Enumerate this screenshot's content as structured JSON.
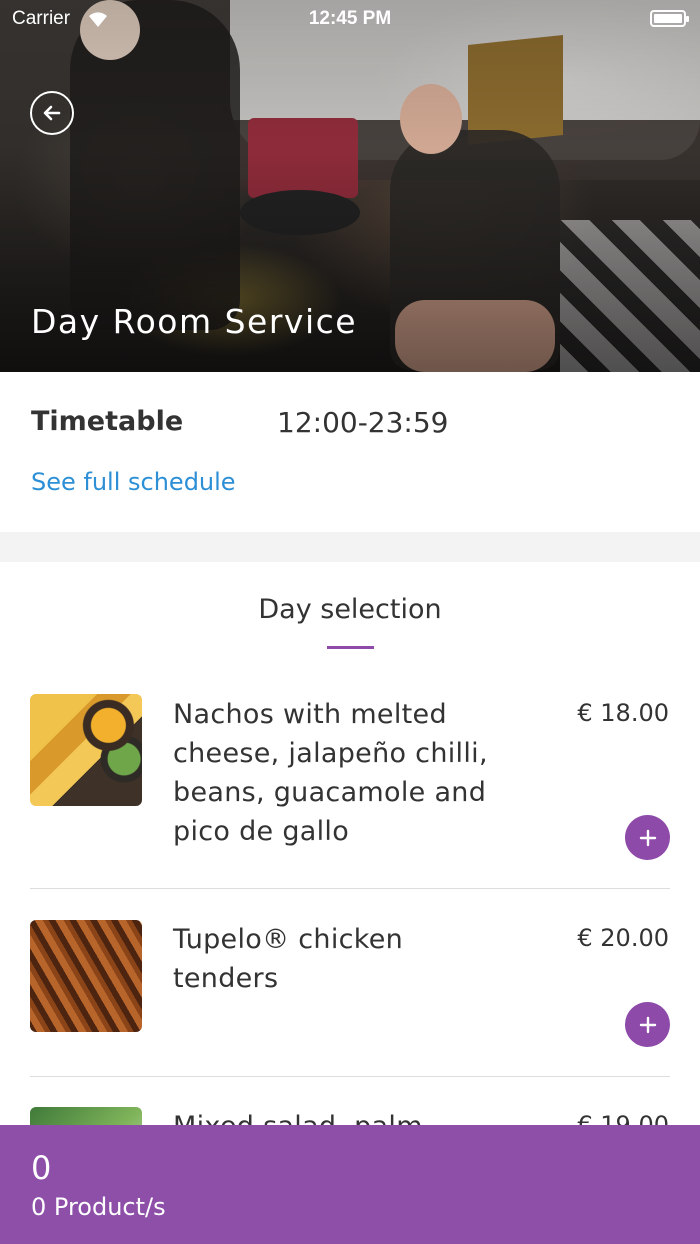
{
  "status_bar": {
    "carrier": "Carrier",
    "time": "12:45 PM"
  },
  "header": {
    "title": "Day Room Service",
    "back_icon": "arrow-left-circle-icon"
  },
  "timetable": {
    "label": "Timetable",
    "hours": "12:00-23:59",
    "schedule_link": "See full schedule"
  },
  "section": {
    "title": "Day selection"
  },
  "menu_items": [
    {
      "name": "Nachos with melted cheese, jalapeño chilli, beans, guacamole and pico de gallo",
      "price": "€ 18.00",
      "image": "nachos-photo"
    },
    {
      "name": "Tupelo® chicken tenders",
      "price": "€ 20.00",
      "image": "chicken-tenders-photo"
    },
    {
      "name": "Mixed salad, palm",
      "price": "€ 19.00",
      "image": "mixed-salad-photo"
    }
  ],
  "cart": {
    "total": "0",
    "count_label": "0 Product/s"
  },
  "colors": {
    "accent": "#8e4aa9",
    "link": "#2d8fd5",
    "cart_bar": "#8e4fa9"
  }
}
